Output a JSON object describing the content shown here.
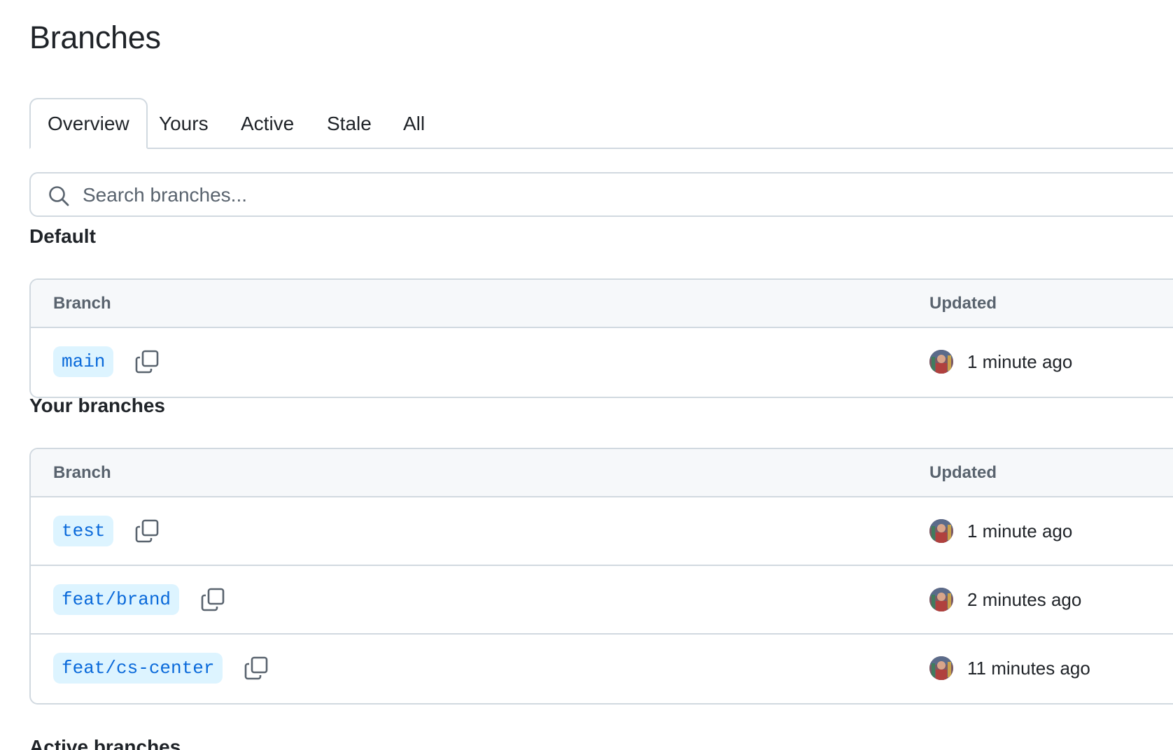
{
  "page": {
    "title": "Branches"
  },
  "tabs": [
    {
      "label": "Overview",
      "selected": true
    },
    {
      "label": "Yours",
      "selected": false
    },
    {
      "label": "Active",
      "selected": false
    },
    {
      "label": "Stale",
      "selected": false
    },
    {
      "label": "All",
      "selected": false
    }
  ],
  "search": {
    "placeholder": "Search branches...",
    "value": "",
    "icon": "search-icon"
  },
  "sections": {
    "default": {
      "title": "Default",
      "columns": {
        "branch": "Branch",
        "updated": "Updated"
      },
      "rows": [
        {
          "branch": "main",
          "updated": "1 minute ago"
        }
      ]
    },
    "yours": {
      "title": "Your branches",
      "columns": {
        "branch": "Branch",
        "updated": "Updated"
      },
      "rows": [
        {
          "branch": "test",
          "updated": "1 minute ago"
        },
        {
          "branch": "feat/brand",
          "updated": "2 minutes ago"
        },
        {
          "branch": "feat/cs-center",
          "updated": "11 minutes ago"
        }
      ]
    },
    "active": {
      "title": "Active branches"
    }
  },
  "colors": {
    "branch_text": "#0969da",
    "branch_bg": "#ddf4ff",
    "border": "#d1d9e0",
    "header_bg": "#f6f8fa",
    "muted_text": "#59636e"
  }
}
